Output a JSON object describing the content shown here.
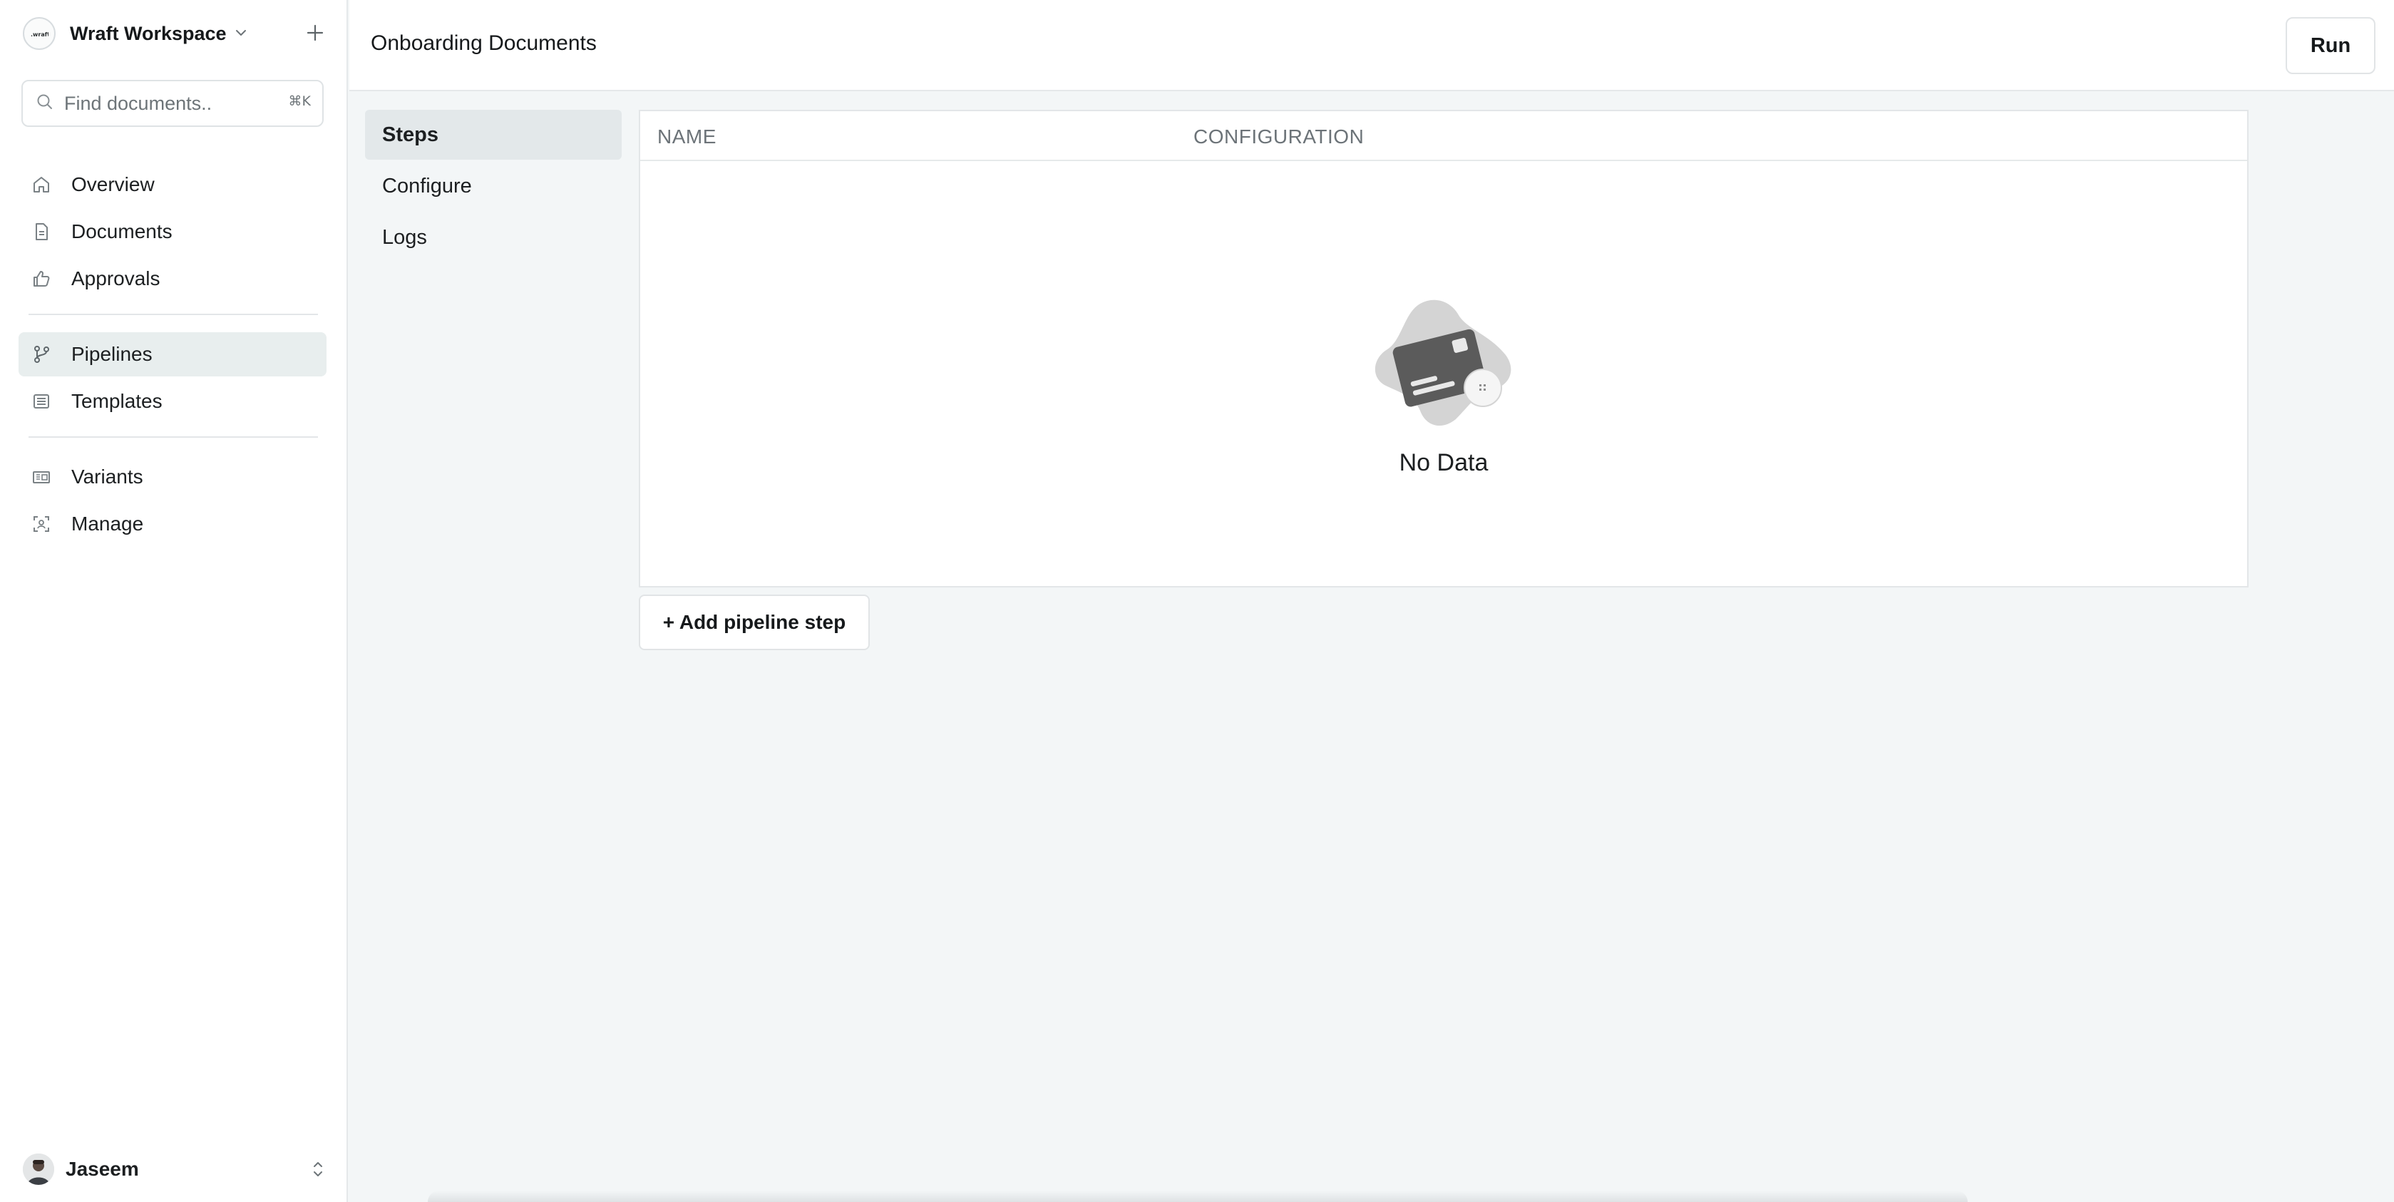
{
  "workspace": {
    "name": "Wraft Workspace",
    "logo_text": "wraft"
  },
  "search": {
    "placeholder": "Find documents..",
    "shortcut": "⌘K"
  },
  "sidebar": {
    "items": [
      {
        "label": "Overview",
        "icon": "home-icon"
      },
      {
        "label": "Documents",
        "icon": "document-icon"
      },
      {
        "label": "Approvals",
        "icon": "thumbs-up-icon"
      },
      {
        "label": "Pipelines",
        "icon": "git-branch-icon",
        "active": true
      },
      {
        "label": "Templates",
        "icon": "template-icon"
      },
      {
        "label": "Variants",
        "icon": "variants-icon"
      },
      {
        "label": "Manage",
        "icon": "manage-icon"
      }
    ]
  },
  "user": {
    "name": "Jaseem"
  },
  "header": {
    "title": "Onboarding Documents",
    "run_label": "Run"
  },
  "subnav": {
    "items": [
      {
        "label": "Steps",
        "active": true
      },
      {
        "label": "Configure"
      },
      {
        "label": "Logs"
      }
    ]
  },
  "table": {
    "columns": [
      "NAME",
      "CONFIGURATION"
    ],
    "rows": [],
    "empty_text": "No Data"
  },
  "actions": {
    "add_step_label": "+ Add pipeline step"
  },
  "colors": {
    "background": "#f3f6f7",
    "active_nav": "#e8eeee",
    "active_subnav": "#e3e8ea",
    "muted_text": "#6c7378"
  }
}
